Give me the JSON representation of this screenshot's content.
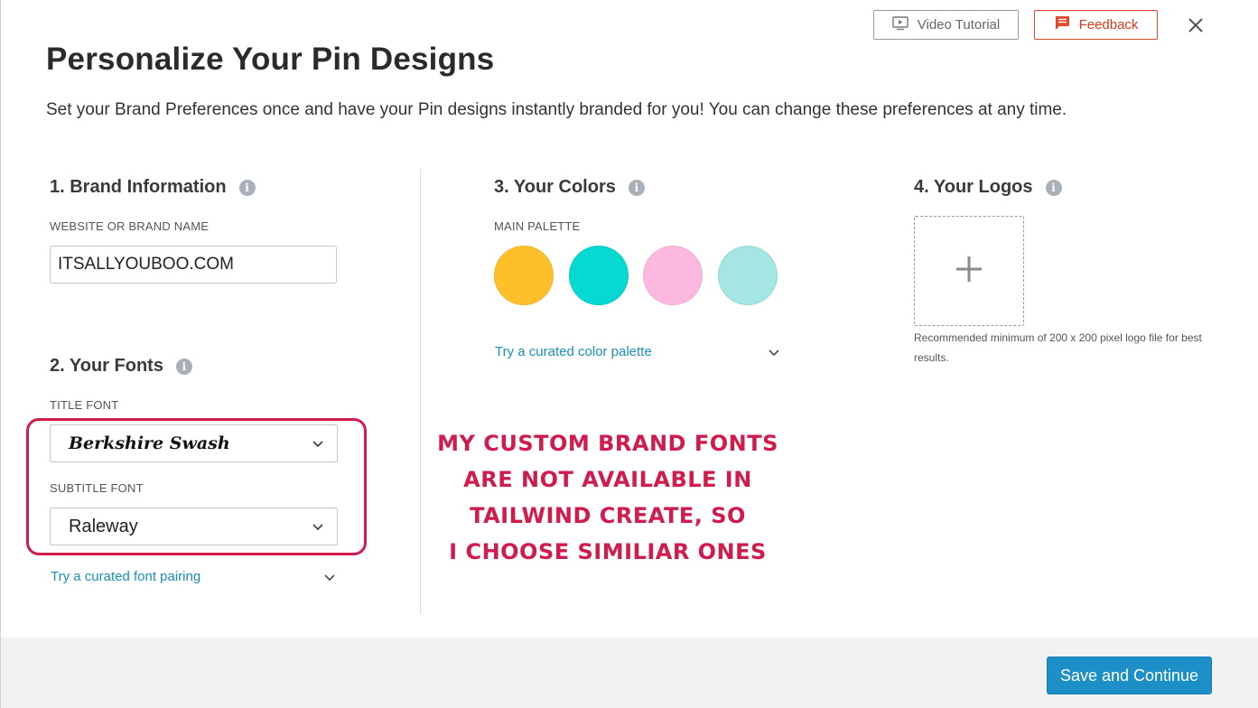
{
  "header": {
    "video_tutorial_label": "Video Tutorial",
    "feedback_label": "Feedback",
    "title": "Personalize Your Pin Designs",
    "subtitle": "Set your Brand Preferences once and have your Pin designs instantly branded for you! You can change these preferences at any time."
  },
  "brand_info": {
    "title": "1. Brand Information",
    "field_label": "WEBSITE OR BRAND NAME",
    "value": "ITSALLYOUBOO.COM"
  },
  "fonts": {
    "title": "2. Your Fonts",
    "title_font_label": "TITLE FONT",
    "title_font_value": "Berkshire Swash",
    "subtitle_font_label": "SUBTITLE FONT",
    "subtitle_font_value": "Raleway",
    "curated_link": "Try a curated font pairing"
  },
  "colors": {
    "title": "3. Your Colors",
    "palette_label": "MAIN PALETTE",
    "swatches": [
      "#fec02a",
      "#05d9d1",
      "#fdb8df",
      "#a3e6e4"
    ],
    "curated_link": "Try a curated color palette"
  },
  "logos": {
    "title": "4. Your Logos",
    "add_icon": "plus-icon",
    "note": "Recommended minimum of 200 x 200 pixel logo file for best results."
  },
  "annotation": {
    "lines": [
      "MY CUSTOM BRAND FONTS",
      "ARE NOT AVAILABLE IN",
      "TAILWIND CREATE, SO",
      "I CHOOSE SIMILIAR ONES"
    ],
    "color": "#d01c4d"
  },
  "footer": {
    "save_label": "Save and Continue"
  }
}
